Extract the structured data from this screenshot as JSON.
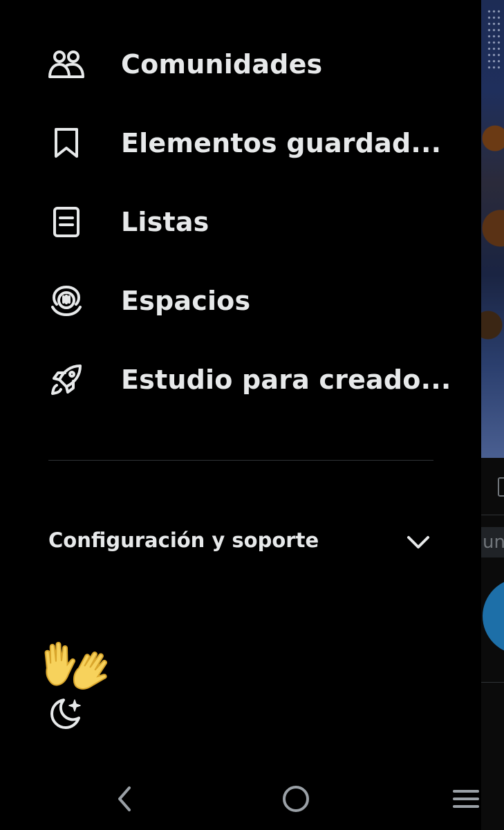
{
  "drawer": {
    "items": [
      {
        "label": "Comunidades",
        "icon": "communities-icon"
      },
      {
        "label": "Elementos guardad...",
        "icon": "bookmark-icon"
      },
      {
        "label": "Listas",
        "icon": "lists-icon"
      },
      {
        "label": "Espacios",
        "icon": "spaces-icon"
      },
      {
        "label": "Estudio para creado...",
        "icon": "rocket-icon"
      }
    ],
    "settings_section": {
      "label": "Configuración y soporte",
      "icon": "chevron-down-icon"
    },
    "footer": {
      "wave_icon": "raised-hands-icon",
      "theme_icon": "moon-sparkle-icon"
    }
  },
  "underlay": {
    "search_fragment": "un"
  },
  "system_nav": {
    "back": "back-icon",
    "home": "home-icon",
    "recents": "recents-icon"
  },
  "colors": {
    "background": "#000000",
    "text": "#e7e9ea",
    "divider": "#2f3336",
    "accent": "#1d6fa8"
  }
}
